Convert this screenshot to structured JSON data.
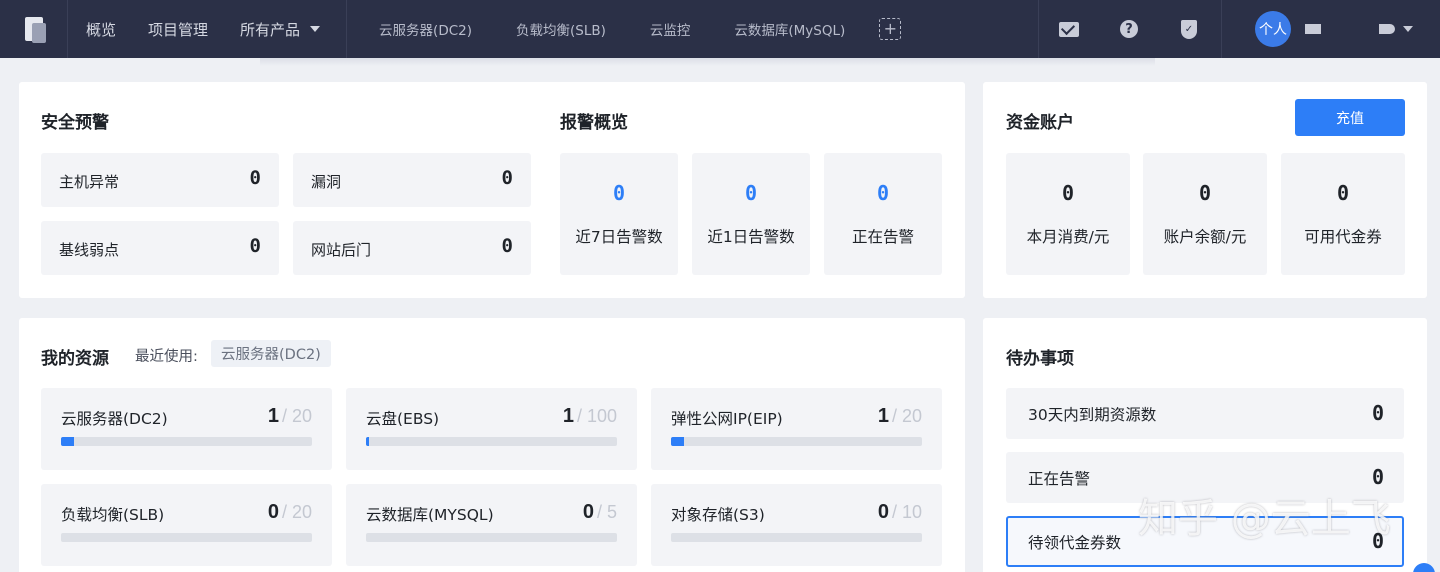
{
  "topbar": {
    "nav_primary": [
      "概览",
      "项目管理",
      "所有产品"
    ],
    "nav_services": [
      "云服务器(DC2)",
      "负载均衡(SLB)",
      "云监控",
      "云数据库(MySQL)"
    ],
    "add_icon": "plus-dashed-icon",
    "avatar_text": "个人"
  },
  "security": {
    "title": "安全预警",
    "items": [
      {
        "label": "主机异常",
        "value": "0"
      },
      {
        "label": "漏洞",
        "value": "0"
      },
      {
        "label": "基线弱点",
        "value": "0"
      },
      {
        "label": "网站后门",
        "value": "0"
      }
    ]
  },
  "alarm": {
    "title": "报警概览",
    "items": [
      {
        "label": "近7日告警数",
        "value": "0"
      },
      {
        "label": "近1日告警数",
        "value": "0"
      },
      {
        "label": "正在告警",
        "value": "0"
      }
    ]
  },
  "funds": {
    "title": "资金账户",
    "recharge_label": "充值",
    "items": [
      {
        "label": "本月消费/元",
        "value": "0"
      },
      {
        "label": "账户余额/元",
        "value": "0"
      },
      {
        "label": "可用代金券",
        "value": "0"
      }
    ]
  },
  "resources": {
    "title": "我的资源",
    "recent_label": "最近使用:",
    "recent_tag": "云服务器(DC2)",
    "items": [
      {
        "label": "云服务器(DC2)",
        "used": "1",
        "total": "/ 20",
        "progress": 0.05
      },
      {
        "label": "云盘(EBS)",
        "used": "1",
        "total": "/ 100",
        "progress": 0.01
      },
      {
        "label": "弹性公网IP(EIP)",
        "used": "1",
        "total": "/ 20",
        "progress": 0.05
      },
      {
        "label": "负载均衡(SLB)",
        "used": "0",
        "total": "/ 20",
        "progress": 0
      },
      {
        "label": "云数据库(MYSQL)",
        "used": "0",
        "total": "/ 5",
        "progress": 0
      },
      {
        "label": "对象存储(S3)",
        "used": "0",
        "total": "/ 10",
        "progress": 0
      }
    ]
  },
  "todo": {
    "title": "待办事项",
    "items": [
      {
        "label": "30天内到期资源数",
        "value": "0"
      },
      {
        "label": "正在告警",
        "value": "0"
      },
      {
        "label": "待领代金券数",
        "value": "0"
      }
    ]
  },
  "watermark": "知乎 @云上飞",
  "colors": {
    "topbar": "#2b3047",
    "accent": "#2d7ef7",
    "tile": "#f3f4f7",
    "page": "#eef0f4"
  }
}
